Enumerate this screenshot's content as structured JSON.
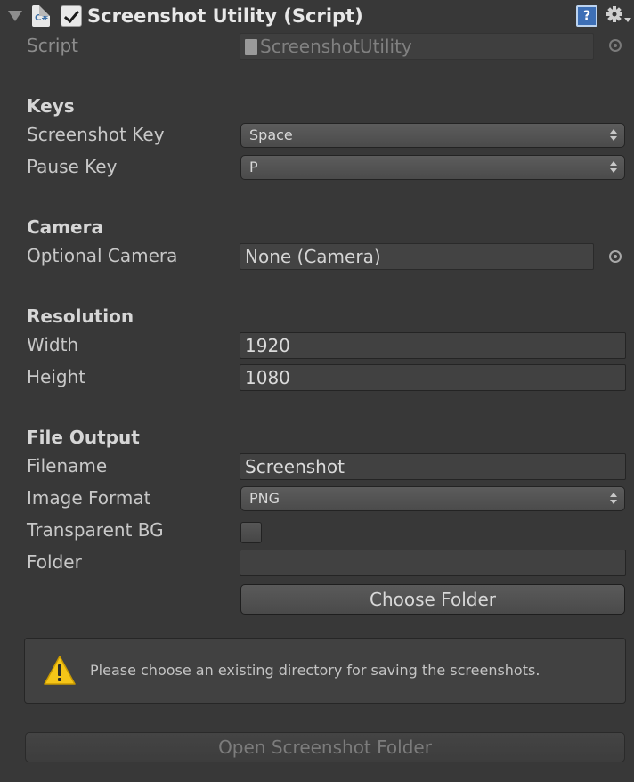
{
  "component": {
    "title": "Screenshot Utility (Script)",
    "script_label": "Script",
    "script_value": "ScreenshotUtility"
  },
  "keys": {
    "section": "Keys",
    "screenshot_key_label": "Screenshot Key",
    "screenshot_key_value": "Space",
    "pause_key_label": "Pause Key",
    "pause_key_value": "P"
  },
  "camera": {
    "section": "Camera",
    "optional_camera_label": "Optional Camera",
    "optional_camera_value": "None (Camera)"
  },
  "resolution": {
    "section": "Resolution",
    "width_label": "Width",
    "width_value": "1920",
    "height_label": "Height",
    "height_value": "1080"
  },
  "file_output": {
    "section": "File Output",
    "filename_label": "Filename",
    "filename_value": "Screenshot",
    "image_format_label": "Image Format",
    "image_format_value": "PNG",
    "transparent_bg_label": "Transparent BG",
    "transparent_bg_checked": false,
    "folder_label": "Folder",
    "folder_value": "",
    "choose_folder_label": "Choose Folder"
  },
  "help_box": {
    "message": "Please choose an existing directory for saving the screenshots."
  },
  "open_folder_button": "Open Screenshot Folder",
  "colors": {
    "background": "#383838",
    "warning": "#f5c518",
    "help_icon": "#3d6fb6"
  }
}
